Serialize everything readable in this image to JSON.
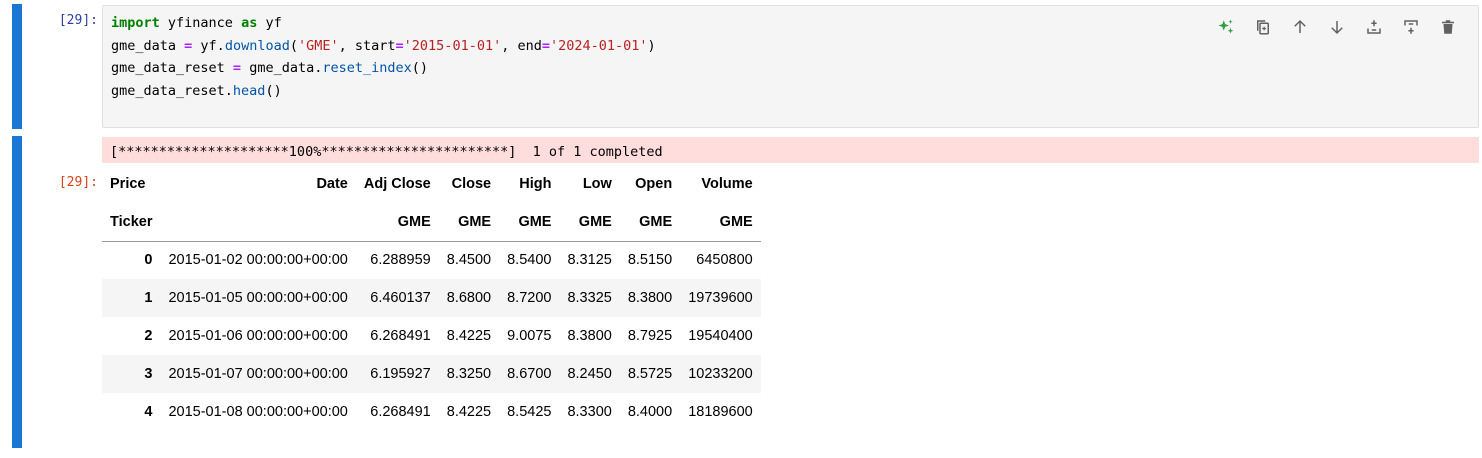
{
  "cell_input": {
    "prompt": "[29]:",
    "code_lines": [
      [
        {
          "t": "import",
          "c": "kw"
        },
        {
          "t": " yfinance "
        },
        {
          "t": "as",
          "c": "kw"
        },
        {
          "t": " yf"
        }
      ],
      [
        {
          "t": "gme_data "
        },
        {
          "t": "=",
          "c": "op"
        },
        {
          "t": " yf."
        },
        {
          "t": "download",
          "c": "fn"
        },
        {
          "t": "("
        },
        {
          "t": "'GME'",
          "c": "str"
        },
        {
          "t": ", start"
        },
        {
          "t": "=",
          "c": "op"
        },
        {
          "t": "'2015-01-01'",
          "c": "str"
        },
        {
          "t": ", end"
        },
        {
          "t": "=",
          "c": "op"
        },
        {
          "t": "'2024-01-01'",
          "c": "str"
        },
        {
          "t": ")"
        }
      ],
      [
        {
          "t": "gme_data_reset "
        },
        {
          "t": "=",
          "c": "op"
        },
        {
          "t": " gme_data."
        },
        {
          "t": "reset_index",
          "c": "fn"
        },
        {
          "t": "()"
        }
      ],
      [
        {
          "t": "gme_data_reset."
        },
        {
          "t": "head",
          "c": "fn"
        },
        {
          "t": "()"
        }
      ]
    ]
  },
  "toolbar": {
    "buttons": [
      {
        "name": "ai-sparkle-button",
        "icon": "sparkle-icon"
      },
      {
        "name": "duplicate-cell-button",
        "icon": "duplicate-icon"
      },
      {
        "name": "move-up-button",
        "icon": "arrow-up-icon"
      },
      {
        "name": "move-down-button",
        "icon": "arrow-down-icon"
      },
      {
        "name": "insert-above-button",
        "icon": "insert-above-icon"
      },
      {
        "name": "insert-below-button",
        "icon": "insert-below-icon"
      },
      {
        "name": "delete-cell-button",
        "icon": "trash-icon"
      }
    ],
    "colors": {
      "sparkle": "#2e9e3e",
      "icon": "#616161"
    }
  },
  "cell_output": {
    "prompt": "[29]:",
    "stderr": "[*********************100%***********************]  1 of 1 completed",
    "table": {
      "header_row1": [
        "Price",
        "Date",
        "Adj Close",
        "Close",
        "High",
        "Low",
        "Open",
        "Volume"
      ],
      "header_row2": [
        "Ticker",
        "",
        "GME",
        "GME",
        "GME",
        "GME",
        "GME",
        "GME"
      ],
      "rows": [
        {
          "index": "0",
          "cells": [
            "2015-01-02 00:00:00+00:00",
            "6.288959",
            "8.4500",
            "8.5400",
            "8.3125",
            "8.5150",
            "6450800"
          ]
        },
        {
          "index": "1",
          "cells": [
            "2015-01-05 00:00:00+00:00",
            "6.460137",
            "8.6800",
            "8.7200",
            "8.3325",
            "8.3800",
            "19739600"
          ]
        },
        {
          "index": "2",
          "cells": [
            "2015-01-06 00:00:00+00:00",
            "6.268491",
            "8.4225",
            "9.0075",
            "8.3800",
            "8.7925",
            "19540400"
          ]
        },
        {
          "index": "3",
          "cells": [
            "2015-01-07 00:00:00+00:00",
            "6.195927",
            "8.3250",
            "8.6700",
            "8.2450",
            "8.5725",
            "10233200"
          ]
        },
        {
          "index": "4",
          "cells": [
            "2015-01-08 00:00:00+00:00",
            "6.268491",
            "8.4225",
            "8.5425",
            "8.3300",
            "8.4000",
            "18189600"
          ]
        }
      ]
    }
  },
  "accent_color": "#1976d2"
}
